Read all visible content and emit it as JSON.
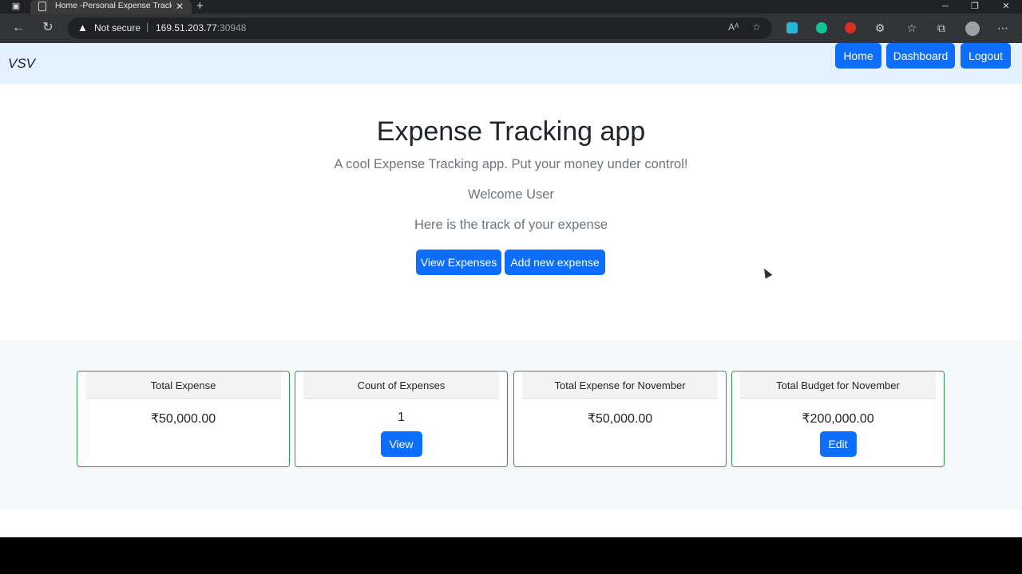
{
  "browser": {
    "tab_title": "Home -Personal Expense Tracker",
    "security_label": "Not secure",
    "url_host": "169.51.203.77",
    "url_port": ":30948"
  },
  "navbar": {
    "brand": "VSV",
    "links": [
      "Home",
      "Dashboard",
      "Logout"
    ]
  },
  "hero": {
    "title": "Expense Tracking app",
    "subtitle": "A cool Expense Tracking app. Put your money under control!",
    "welcome_prefix": "Welcome",
    "username": "User",
    "track_text": "Here is the track of your expense",
    "view_button": "View Expenses",
    "add_button": "Add new expense"
  },
  "cards": [
    {
      "header": "Total Expense",
      "value": "₹50,000.00",
      "button": ""
    },
    {
      "header": "Count of Expenses",
      "value": "1",
      "button": "View"
    },
    {
      "header": "Total Expense for November",
      "value": "₹50,000.00",
      "button": ""
    },
    {
      "header": "Total Budget for November",
      "value": "₹200,000.00",
      "button": "Edit"
    }
  ],
  "colors": {
    "primary": "#0d6efd",
    "navbar_bg": "#e3f0fd",
    "card_border": "#2e9a4f"
  }
}
